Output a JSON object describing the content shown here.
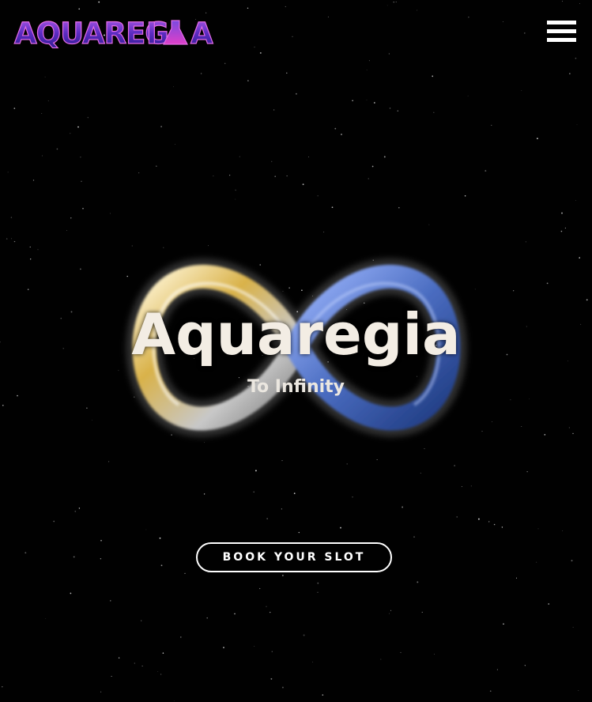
{
  "header": {
    "logo_text": "AQUAREGIA",
    "menu_icon": "hamburger-menu-icon"
  },
  "hero": {
    "title": "Aquaregia",
    "subtitle": "To Infinity",
    "background_icon": "infinity-symbol",
    "cta_label": "BOOK YOUR SLOT"
  },
  "colors": {
    "background": "#000000",
    "text": "#ffffff",
    "title_text": "#f3ede4",
    "logo_purple": "#7a2fd0",
    "logo_magenta": "#d83ad8",
    "infinity_gold": "#c8a030",
    "infinity_silver": "#d0d0d0",
    "infinity_blue": "#4a70c8"
  }
}
